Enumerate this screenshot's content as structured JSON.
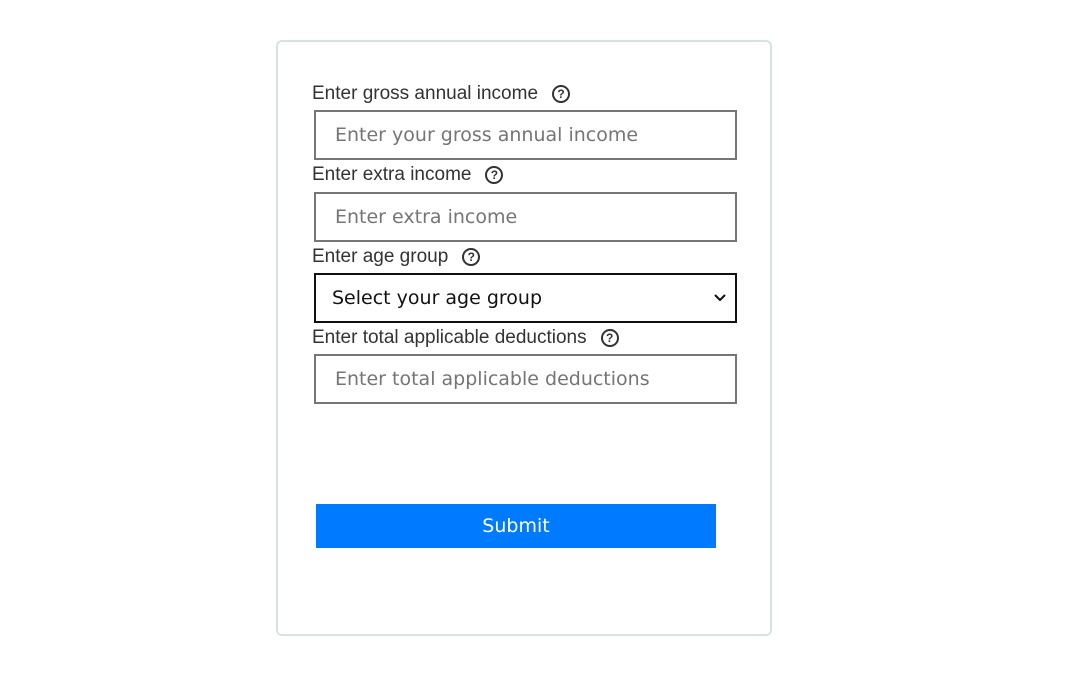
{
  "form": {
    "fields": [
      {
        "label": "Enter gross annual income",
        "help_icon": "?",
        "placeholder": "Enter your gross annual income",
        "value": ""
      },
      {
        "label": "Enter extra income",
        "help_icon": "?",
        "placeholder": "Enter extra income",
        "value": ""
      },
      {
        "label": "Enter age group",
        "help_icon": "?",
        "selected": "Select your age group"
      },
      {
        "label": "Enter total applicable deductions",
        "help_icon": "?",
        "placeholder": "Enter total applicable deductions",
        "value": ""
      }
    ],
    "submit_label": "Submit"
  },
  "icons": {
    "help": "question-circle-icon",
    "dropdown": "chevron-down-icon"
  },
  "colors": {
    "accent": "#007bff",
    "card_border": "#d6e2e6",
    "label_text": "#333333"
  }
}
